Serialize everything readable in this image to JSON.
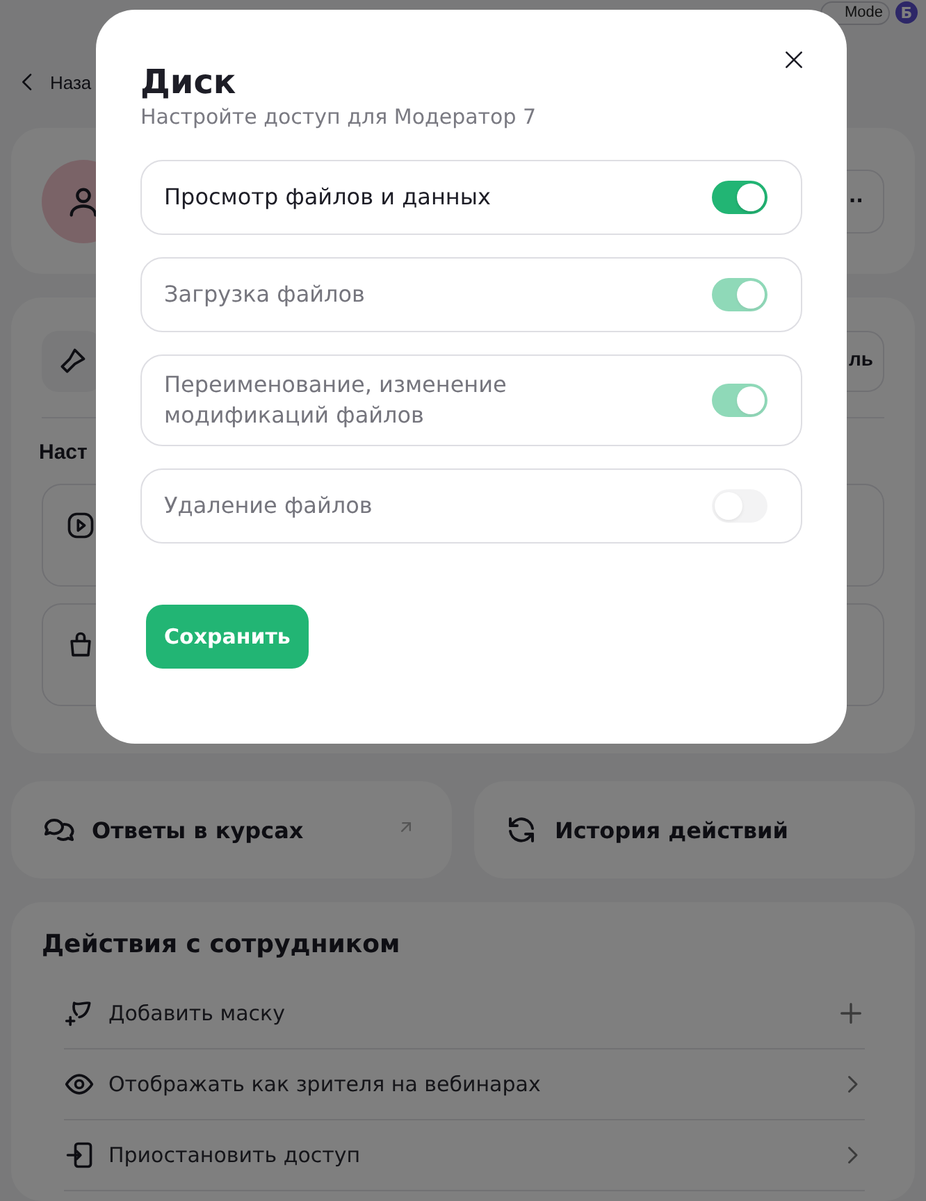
{
  "top_bar": {
    "mode_label": "Mode",
    "avatar_letter": "Б"
  },
  "back_link": "Наза",
  "profile_card": {
    "menu": "··"
  },
  "settings_card": {
    "button_fragment": "ль",
    "heading_fragment": "Наст"
  },
  "quick_links": [
    {
      "kind": "answers",
      "label": "Ответы в курсах",
      "external": true
    },
    {
      "kind": "history",
      "label": "История действий",
      "external": false
    }
  ],
  "actions": {
    "title": "Действия с сотрудником",
    "items": [
      {
        "kind": "add-mask",
        "label": "Добавить маску"
      },
      {
        "kind": "viewer",
        "label": "Отображать как зрителя на вебинарах"
      },
      {
        "kind": "suspend",
        "label": "Приостановить доступ"
      }
    ]
  },
  "modal": {
    "title": "Диск",
    "subtitle": "Настройте доступ для Модератор 7",
    "permissions": [
      {
        "label": "Просмотр файлов и данных",
        "on": true,
        "disabled": false
      },
      {
        "label": "Загрузка файлов",
        "on": true,
        "disabled": true
      },
      {
        "label": "Переименование, изменение модификаций файлов",
        "on": true,
        "disabled": true
      },
      {
        "label": "Удаление файлов",
        "on": false,
        "disabled": true
      }
    ],
    "save_button": "Сохранить"
  }
}
